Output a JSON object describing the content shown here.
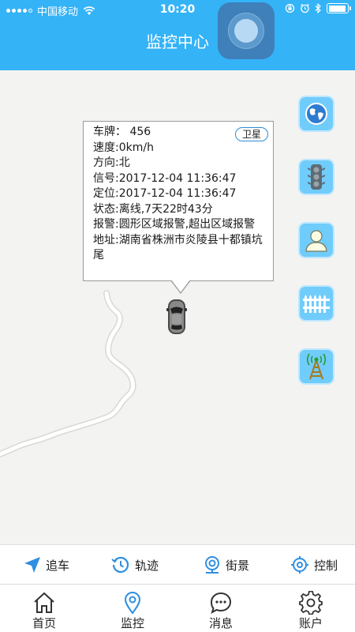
{
  "status_bar": {
    "carrier": "中国移动",
    "time": "10:20"
  },
  "header": {
    "title": "监控中心"
  },
  "popup": {
    "satellite_button": "卫星",
    "rows": [
      "车牌：  456",
      "速度:0km/h",
      "方向:北",
      "信号:2017-12-04 11:36:47",
      "定位:2017-12-04 11:36:47",
      "状态:离线,7天22时43分",
      "报警:圆形区域报警,超出区域报警",
      "地址:湖南省株洲市炎陵县十都镇坑尾"
    ]
  },
  "side_buttons": [
    {
      "icon": "globe-icon"
    },
    {
      "icon": "traffic-light-icon"
    },
    {
      "icon": "person-icon"
    },
    {
      "icon": "fence-icon"
    },
    {
      "icon": "signal-tower-icon"
    }
  ],
  "actions": {
    "chase": "追车",
    "track": "轨迹",
    "street_view": "街景",
    "control": "控制"
  },
  "tabs": {
    "home": "首页",
    "monitor": "监控",
    "message": "消息",
    "account": "账户"
  },
  "colors": {
    "header": "#34b3f7",
    "side_button": "#70ccfb",
    "accent_icon": "#2f8fe0"
  }
}
